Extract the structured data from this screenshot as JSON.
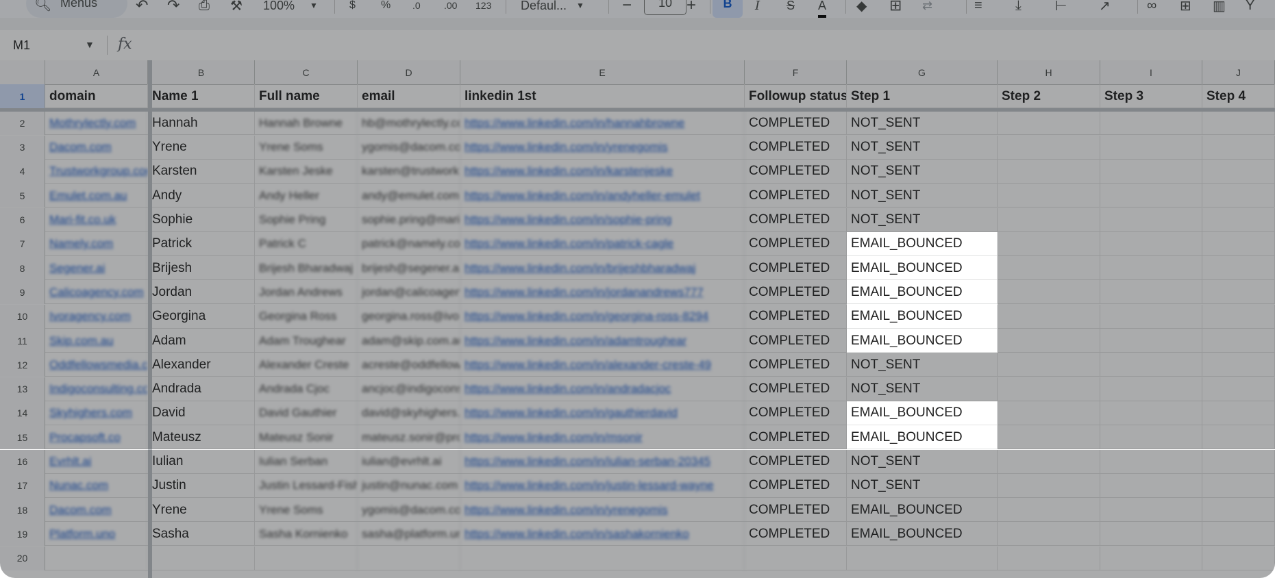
{
  "toolbar": {
    "menus_label": "Menus",
    "zoom": "100%",
    "currency": "$",
    "percent": "%",
    "decimal_dec": ".0",
    "decimal_inc": ".00",
    "number_format": "123",
    "font": "Defaul...",
    "font_size": "10",
    "bold": "B",
    "italic": "I",
    "strike": "S",
    "text_color": "A",
    "icons": [
      "search-icon",
      "undo-icon",
      "redo-icon",
      "print-icon",
      "paint-format-icon",
      "bold-icon",
      "italic-icon",
      "strikethrough-icon",
      "text-color-icon",
      "fill-color-icon",
      "borders-icon",
      "merge-icon",
      "align-icon",
      "valign-icon",
      "wrap-icon",
      "rotate-icon",
      "link-icon",
      "comment-icon",
      "chart-icon",
      "filter-icon"
    ]
  },
  "formula_bar": {
    "name_box": "M1",
    "fx": "fx"
  },
  "columns": [
    {
      "letter": "A"
    },
    {
      "letter": "B"
    },
    {
      "letter": "C"
    },
    {
      "letter": "D"
    },
    {
      "letter": "E"
    },
    {
      "letter": "F"
    },
    {
      "letter": "G"
    },
    {
      "letter": "H"
    },
    {
      "letter": "I"
    },
    {
      "letter": "J"
    }
  ],
  "header_row": {
    "num": "1",
    "cells": [
      "domain",
      "Name 1",
      "Full name",
      "email",
      "linkedin 1st",
      "Followup status",
      "Step 1",
      "Step 2",
      "Step 3",
      "Step 4"
    ]
  },
  "rows": [
    {
      "num": "2",
      "domain": "Mothrylectly.com",
      "name": "Hannah",
      "full": "Hannah Browne",
      "email": "hb@mothrylectly.com",
      "link": "https://www.linkedin.com/in/hannahbrowne",
      "status": "COMPLETED",
      "step1": "NOT_SENT"
    },
    {
      "num": "3",
      "domain": "Dacom.com",
      "name": "Yrene",
      "full": "Yrene Soms",
      "email": "ygomis@dacom.com",
      "link": "https://www.linkedin.com/in/yrenegomis",
      "status": "COMPLETED",
      "step1": "NOT_SENT"
    },
    {
      "num": "4",
      "domain": "Trustworkgroup.com",
      "name": "Karsten",
      "full": "Karsten Jeske",
      "email": "karsten@trustwork.com",
      "link": "https://www.linkedin.com/in/karstenjeske",
      "status": "COMPLETED",
      "step1": "NOT_SENT"
    },
    {
      "num": "5",
      "domain": "Emulet.com.au",
      "name": "Andy",
      "full": "Andy Heller",
      "email": "andy@emulet.com.au",
      "link": "https://www.linkedin.com/in/andyheller-emulet",
      "status": "COMPLETED",
      "step1": "NOT_SENT"
    },
    {
      "num": "6",
      "domain": "Mari-fit.co.uk",
      "name": "Sophie",
      "full": "Sophie Pring",
      "email": "sophie.pring@mari-fit.co.uk",
      "link": "https://www.linkedin.com/in/sophie-pring",
      "status": "COMPLETED",
      "step1": "NOT_SENT"
    },
    {
      "num": "7",
      "domain": "Namely.com",
      "name": "Patrick",
      "full": "Patrick C",
      "email": "patrick@namely.com",
      "link": "https://www.linkedin.com/in/patrick-cagle",
      "status": "COMPLETED",
      "step1": "EMAIL_BOUNCED"
    },
    {
      "num": "8",
      "domain": "Segener.ai",
      "name": "Brijesh",
      "full": "Brijesh Bharadwaj",
      "email": "brijesh@segener.ai",
      "link": "https://www.linkedin.com/in/brijeshbharadwaj",
      "status": "COMPLETED",
      "step1": "EMAIL_BOUNCED"
    },
    {
      "num": "9",
      "domain": "Calicoagency.com",
      "name": "Jordan",
      "full": "Jordan Andrews",
      "email": "jordan@calicoagency.com",
      "link": "https://www.linkedin.com/in/jordanandrews777",
      "status": "COMPLETED",
      "step1": "EMAIL_BOUNCED"
    },
    {
      "num": "10",
      "domain": "Ivoragency.com",
      "name": "Georgina",
      "full": "Georgina Ross",
      "email": "georgina.ross@ivoragency.com",
      "link": "https://www.linkedin.com/in/georgina-ross-8294",
      "status": "COMPLETED",
      "step1": "EMAIL_BOUNCED"
    },
    {
      "num": "11",
      "domain": "Skip.com.au",
      "name": "Adam",
      "full": "Adam Troughear",
      "email": "adam@skip.com.au",
      "link": "https://www.linkedin.com/in/adamtroughear",
      "status": "COMPLETED",
      "step1": "EMAIL_BOUNCED"
    },
    {
      "num": "12",
      "domain": "Oddfellowsmedia.com",
      "name": "Alexander",
      "full": "Alexander Creste",
      "email": "acreste@oddfellowsmedia.com",
      "link": "https://www.linkedin.com/in/alexander-creste-49",
      "status": "COMPLETED",
      "step1": "NOT_SENT"
    },
    {
      "num": "13",
      "domain": "Indigoconsulting.com",
      "name": "Andrada",
      "full": "Andrada Cjoc",
      "email": "ancjoc@indigoconsulting.com",
      "link": "https://www.linkedin.com/in/andradacjoc",
      "status": "COMPLETED",
      "step1": "NOT_SENT"
    },
    {
      "num": "14",
      "domain": "Skyhighers.com",
      "name": "David",
      "full": "David Gauthier",
      "email": "david@skyhighers.com",
      "link": "https://www.linkedin.com/in/gauthierdavid",
      "status": "COMPLETED",
      "step1": "EMAIL_BOUNCED"
    },
    {
      "num": "15",
      "domain": "Procapsoft.co",
      "name": "Mateusz",
      "full": "Mateusz Sonir",
      "email": "mateusz.sonir@procapsoft.co",
      "link": "https://www.linkedin.com/in/msonir",
      "status": "COMPLETED",
      "step1": "EMAIL_BOUNCED"
    },
    {
      "num": "16",
      "domain": "Evrhlt.ai",
      "name": "Iulian",
      "full": "Iulian Serban",
      "email": "iulian@evrhlt.ai",
      "link": "https://www.linkedin.com/in/iulian-serban-20345",
      "status": "COMPLETED",
      "step1": "NOT_SENT"
    },
    {
      "num": "17",
      "domain": "Nunac.com",
      "name": "Justin",
      "full": "Justin Lessard-Fisher",
      "email": "justin@nunac.com",
      "link": "https://www.linkedin.com/in/justin-lessard-wayne",
      "status": "COMPLETED",
      "step1": "NOT_SENT"
    },
    {
      "num": "18",
      "domain": "Dacom.com",
      "name": "Yrene",
      "full": "Yrene Soms",
      "email": "ygomis@dacom.com",
      "link": "https://www.linkedin.com/in/yrenegomis",
      "status": "COMPLETED",
      "step1": "EMAIL_BOUNCED"
    },
    {
      "num": "19",
      "domain": "Platform.uno",
      "name": "Sasha",
      "full": "Sasha Kornienko",
      "email": "sasha@platform.uno",
      "link": "https://www.linkedin.com/in/sashakornienko",
      "status": "COMPLETED",
      "step1": "EMAIL_BOUNCED"
    },
    {
      "num": "20",
      "domain": "",
      "name": "",
      "full": "",
      "email": "",
      "link": "",
      "status": "",
      "step1": ""
    }
  ],
  "colors": {
    "selected_row_header": "#d3e3fd",
    "link": "#1155cc",
    "dim_overlay": "rgba(32,33,36,0.38)"
  }
}
